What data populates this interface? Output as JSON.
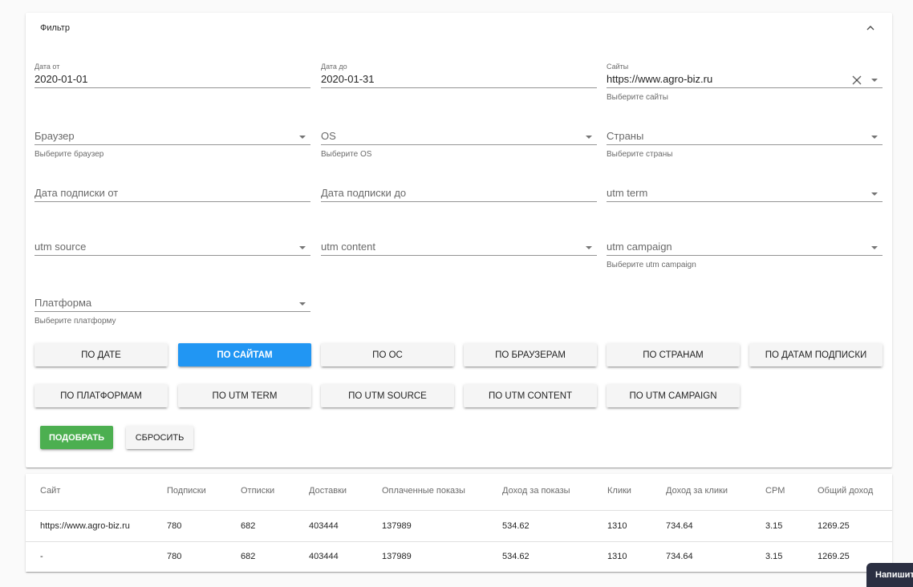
{
  "filter": {
    "title": "Фильтр",
    "date_from": {
      "label": "Дата от",
      "value": "2020-01-01"
    },
    "date_to": {
      "label": "Дата до",
      "value": "2020-01-31"
    },
    "sites": {
      "label": "Сайты",
      "value": "https://www.agro-biz.ru",
      "hint": "Выберите сайты"
    },
    "browser": {
      "placeholder": "Браузер",
      "hint": "Выберите браузер"
    },
    "os": {
      "placeholder": "OS",
      "hint": "Выберите OS"
    },
    "countries": {
      "placeholder": "Страны",
      "hint": "Выберите страны"
    },
    "sub_date_from": {
      "placeholder": "Дата подписки от"
    },
    "sub_date_to": {
      "placeholder": "Дата подписки до"
    },
    "utm_term": {
      "placeholder": "utm term"
    },
    "utm_source": {
      "placeholder": "utm source"
    },
    "utm_content": {
      "placeholder": "utm content"
    },
    "utm_campaign": {
      "placeholder": "utm campaign",
      "hint": "Выберите utm campaign"
    },
    "platform": {
      "placeholder": "Платформа",
      "hint": "Выберите платформу"
    }
  },
  "group_buttons": [
    "по дате",
    "по сайтам",
    "по ос",
    "по браузерам",
    "по странам",
    "по датам подписки",
    "по платформам",
    "по utm term",
    "по utm source",
    "по utm content",
    "по utm campaign"
  ],
  "active_group": "по сайтам",
  "actions": {
    "apply": "Подобрать",
    "reset": "Сбросить"
  },
  "table": {
    "headers": [
      "Сайт",
      "Подписки",
      "Отписки",
      "Доставки",
      "Оплаченные показы",
      "Доход за показы",
      "Клики",
      "Доход за клики",
      "CPM",
      "Общий доход"
    ],
    "rows": [
      [
        "https://www.agro-biz.ru",
        "780",
        "682",
        "403444",
        "137989",
        "534.62",
        "1310",
        "734.64",
        "3.15",
        "1269.25"
      ],
      [
        "-",
        "780",
        "682",
        "403444",
        "137989",
        "534.62",
        "1310",
        "734.64",
        "3.15",
        "1269.25"
      ]
    ]
  },
  "chat": {
    "label": "Напишите нам"
  },
  "colors": {
    "primary": "#2196f3",
    "success": "#4caf50",
    "chat_bg": "#2b2f42"
  }
}
